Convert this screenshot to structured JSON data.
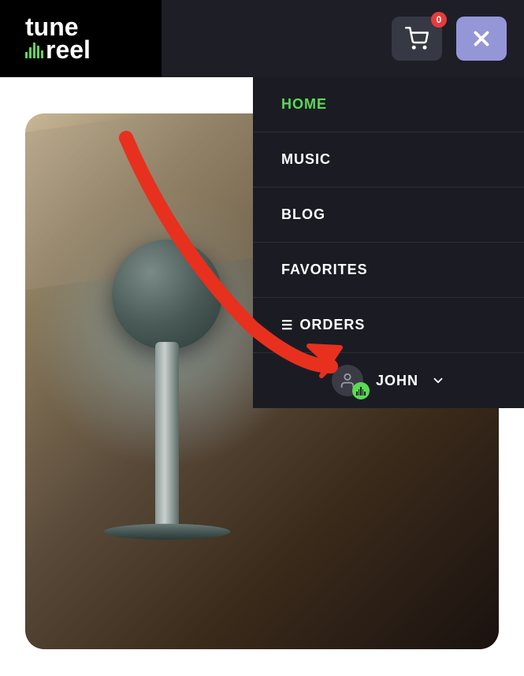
{
  "brand": {
    "line1": "tune",
    "line2": "reel"
  },
  "header": {
    "cart_count": "0"
  },
  "menu": {
    "items": [
      {
        "label": "HOME",
        "active": true
      },
      {
        "label": "MUSIC",
        "active": false
      },
      {
        "label": "BLOG",
        "active": false
      },
      {
        "label": "FAVORITES",
        "active": false
      },
      {
        "label": "ORDERS",
        "active": false,
        "has_icon": true
      }
    ]
  },
  "user": {
    "name": "JOHN"
  },
  "colors": {
    "accent": "#5bd955",
    "close_btn": "#9596d8",
    "badge": "#e63b3b"
  }
}
